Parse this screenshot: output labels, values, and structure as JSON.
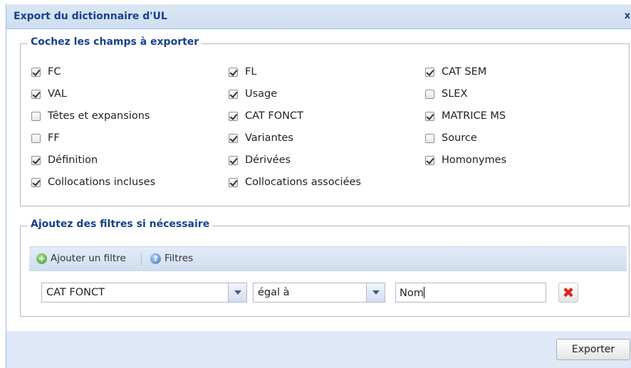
{
  "dialog": {
    "title": "Export du dictionnaire d'UL",
    "close_label": "x"
  },
  "fields_section": {
    "legend": "Cochez les champs à exporter",
    "checkboxes": [
      {
        "label": "FC",
        "checked": true
      },
      {
        "label": "VAL",
        "checked": true
      },
      {
        "label": "Têtes et expansions",
        "checked": false
      },
      {
        "label": "FF",
        "checked": false
      },
      {
        "label": "Définition",
        "checked": true
      },
      {
        "label": "Collocations incluses",
        "checked": true
      },
      {
        "label": "FL",
        "checked": true
      },
      {
        "label": "Usage",
        "checked": true
      },
      {
        "label": "CAT FONCT",
        "checked": true
      },
      {
        "label": "Variantes",
        "checked": true
      },
      {
        "label": "Dérivées",
        "checked": true
      },
      {
        "label": "Collocations associées",
        "checked": true
      },
      {
        "label": "CAT SEM",
        "checked": true
      },
      {
        "label": "SLEX",
        "checked": false
      },
      {
        "label": "MATRICE MS",
        "checked": true
      },
      {
        "label": "Source",
        "checked": false
      },
      {
        "label": "Homonymes",
        "checked": true
      }
    ]
  },
  "filters_section": {
    "legend": "Ajoutez des filtres si nécessaire",
    "toolbar": {
      "add_label": "Ajouter un filtre",
      "filters_label": "Filtres"
    },
    "filter_row": {
      "field_value": "CAT FONCT",
      "operator_value": "égal à",
      "value": "Nom"
    }
  },
  "footer": {
    "export_label": "Exporter"
  }
}
